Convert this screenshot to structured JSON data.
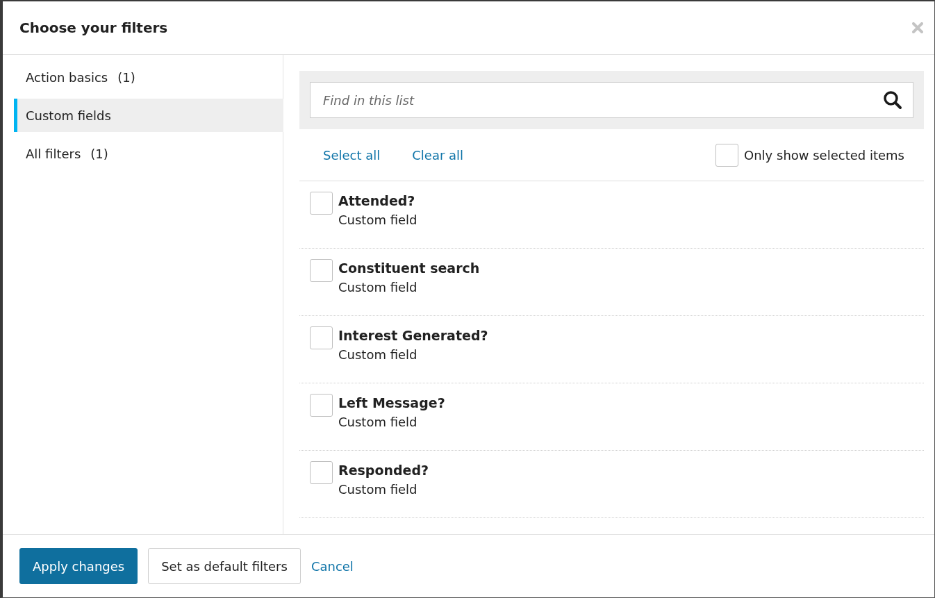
{
  "dialog": {
    "title": "Choose your filters"
  },
  "sidebar": {
    "items": [
      {
        "label": "Action basics",
        "count": "(1)",
        "selected": false
      },
      {
        "label": "Custom fields",
        "selected": true
      },
      {
        "label": "All filters",
        "count": "(1)",
        "selected": false
      }
    ]
  },
  "search": {
    "placeholder": "Find in this list"
  },
  "actions": {
    "select_all": "Select all",
    "clear_all": "Clear all",
    "only_selected": {
      "label": "Only show selected items",
      "checked": false
    }
  },
  "items": [
    {
      "title": "Attended?",
      "subtitle": "Custom field",
      "checked": false
    },
    {
      "title": "Constituent search",
      "subtitle": "Custom field",
      "checked": false
    },
    {
      "title": "Interest Generated?",
      "subtitle": "Custom field",
      "checked": false
    },
    {
      "title": "Left Message?",
      "subtitle": "Custom field",
      "checked": false
    },
    {
      "title": "Responded?",
      "subtitle": "Custom field",
      "checked": false
    }
  ],
  "footer": {
    "apply": "Apply changes",
    "set_default": "Set as default filters",
    "cancel": "Cancel"
  }
}
